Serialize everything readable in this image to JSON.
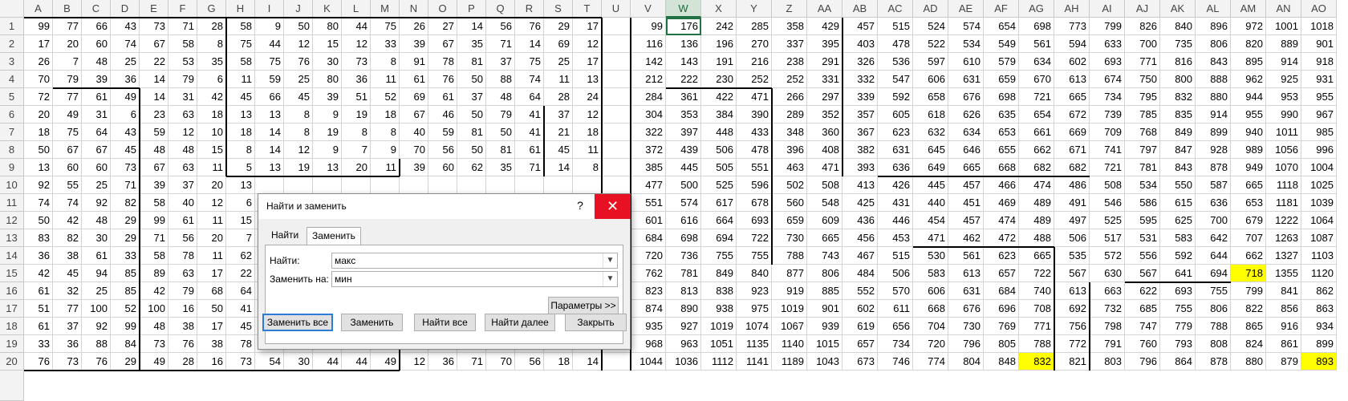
{
  "columns": [
    "A",
    "B",
    "C",
    "D",
    "E",
    "F",
    "G",
    "H",
    "I",
    "J",
    "K",
    "L",
    "M",
    "N",
    "O",
    "P",
    "Q",
    "R",
    "S",
    "T",
    "U",
    "V",
    "W",
    "X",
    "Y",
    "Z",
    "AA",
    "AB",
    "AC",
    "AD",
    "AE",
    "AF",
    "AG",
    "AH",
    "AI",
    "AJ",
    "AK",
    "AL",
    "AM",
    "AN",
    "AO"
  ],
  "rows": [
    "1",
    "2",
    "3",
    "4",
    "5",
    "6",
    "7",
    "8",
    "9",
    "10",
    "11",
    "12",
    "13",
    "14",
    "15",
    "16",
    "17",
    "18",
    "19",
    "20"
  ],
  "selected_column": "W",
  "active_cell": "W1",
  "highlighted_cells": [
    "AM15",
    "AG20",
    "AO20"
  ],
  "highlight_color": "#ffff00",
  "grid": [
    [
      "99",
      "77",
      "66",
      "43",
      "73",
      "71",
      "28",
      "58",
      "9",
      "50",
      "80",
      "44",
      "75",
      "26",
      "27",
      "14",
      "56",
      "76",
      "29",
      "17",
      "",
      "99",
      "176",
      "242",
      "285",
      "358",
      "429",
      "457",
      "515",
      "524",
      "574",
      "654",
      "698",
      "773",
      "799",
      "826",
      "840",
      "896",
      "972",
      "1001",
      "1018"
    ],
    [
      "17",
      "20",
      "60",
      "74",
      "67",
      "58",
      "8",
      "75",
      "44",
      "12",
      "15",
      "12",
      "33",
      "39",
      "67",
      "35",
      "71",
      "14",
      "69",
      "12",
      "",
      "116",
      "136",
      "196",
      "270",
      "337",
      "395",
      "403",
      "478",
      "522",
      "534",
      "549",
      "561",
      "594",
      "633",
      "700",
      "735",
      "806",
      "820",
      "889",
      "901"
    ],
    [
      "26",
      "7",
      "48",
      "25",
      "22",
      "53",
      "35",
      "58",
      "75",
      "76",
      "30",
      "73",
      "8",
      "91",
      "78",
      "81",
      "37",
      "75",
      "25",
      "17",
      "",
      "142",
      "143",
      "191",
      "216",
      "238",
      "291",
      "326",
      "536",
      "597",
      "610",
      "579",
      "634",
      "602",
      "693",
      "771",
      "816",
      "843",
      "895",
      "914",
      "918"
    ],
    [
      "70",
      "79",
      "39",
      "36",
      "14",
      "79",
      "6",
      "11",
      "59",
      "25",
      "80",
      "36",
      "11",
      "61",
      "76",
      "50",
      "88",
      "74",
      "11",
      "13",
      "",
      "212",
      "222",
      "230",
      "252",
      "252",
      "331",
      "332",
      "547",
      "606",
      "631",
      "659",
      "670",
      "613",
      "674",
      "750",
      "800",
      "888",
      "962",
      "925",
      "931"
    ],
    [
      "72",
      "77",
      "61",
      "49",
      "14",
      "31",
      "42",
      "45",
      "66",
      "45",
      "39",
      "51",
      "52",
      "69",
      "61",
      "37",
      "48",
      "64",
      "28",
      "24",
      "",
      "284",
      "361",
      "422",
      "471",
      "266",
      "297",
      "339",
      "592",
      "658",
      "676",
      "698",
      "721",
      "665",
      "734",
      "795",
      "832",
      "880",
      "944",
      "953",
      "955"
    ],
    [
      "20",
      "49",
      "31",
      "6",
      "23",
      "63",
      "18",
      "13",
      "13",
      "8",
      "9",
      "19",
      "18",
      "67",
      "46",
      "50",
      "79",
      "41",
      "37",
      "12",
      "",
      "304",
      "353",
      "384",
      "390",
      "289",
      "352",
      "357",
      "605",
      "618",
      "626",
      "635",
      "654",
      "672",
      "739",
      "785",
      "835",
      "914",
      "955",
      "990",
      "967"
    ],
    [
      "18",
      "75",
      "64",
      "43",
      "59",
      "12",
      "10",
      "18",
      "14",
      "8",
      "19",
      "8",
      "8",
      "40",
      "59",
      "81",
      "50",
      "41",
      "21",
      "18",
      "",
      "322",
      "397",
      "448",
      "433",
      "348",
      "360",
      "367",
      "623",
      "632",
      "634",
      "653",
      "661",
      "669",
      "709",
      "768",
      "849",
      "899",
      "940",
      "1011",
      "985"
    ],
    [
      "50",
      "67",
      "67",
      "45",
      "48",
      "48",
      "15",
      "8",
      "14",
      "12",
      "9",
      "7",
      "9",
      "70",
      "56",
      "50",
      "81",
      "61",
      "45",
      "11",
      "",
      "372",
      "439",
      "506",
      "478",
      "396",
      "408",
      "382",
      "631",
      "645",
      "646",
      "655",
      "662",
      "671",
      "741",
      "797",
      "847",
      "928",
      "989",
      "1056",
      "996"
    ],
    [
      "13",
      "60",
      "60",
      "73",
      "67",
      "63",
      "11",
      "5",
      "13",
      "19",
      "13",
      "20",
      "11",
      "39",
      "60",
      "62",
      "35",
      "71",
      "14",
      "8",
      "",
      "385",
      "445",
      "505",
      "551",
      "463",
      "471",
      "393",
      "636",
      "649",
      "665",
      "668",
      "682",
      "682",
      "721",
      "781",
      "843",
      "878",
      "949",
      "1070",
      "1004"
    ],
    [
      "92",
      "55",
      "25",
      "71",
      "39",
      "37",
      "20",
      "13",
      "",
      "",
      "",
      "",
      "",
      "",
      "",
      "",
      "",
      "",
      "",
      "",
      "",
      "477",
      "500",
      "525",
      "596",
      "502",
      "508",
      "413",
      "426",
      "445",
      "457",
      "466",
      "474",
      "486",
      "508",
      "534",
      "550",
      "587",
      "665",
      "1118",
      "1025"
    ],
    [
      "74",
      "74",
      "92",
      "82",
      "58",
      "40",
      "12",
      "6",
      "",
      "",
      "",
      "",
      "",
      "",
      "",
      "",
      "",
      "",
      "",
      "",
      "",
      "551",
      "574",
      "617",
      "678",
      "560",
      "548",
      "425",
      "431",
      "440",
      "451",
      "469",
      "489",
      "491",
      "546",
      "586",
      "615",
      "636",
      "653",
      "1181",
      "1039"
    ],
    [
      "50",
      "42",
      "48",
      "29",
      "99",
      "61",
      "11",
      "15",
      "",
      "",
      "",
      "",
      "",
      "",
      "",
      "",
      "",
      "",
      "",
      "",
      "",
      "601",
      "616",
      "664",
      "693",
      "659",
      "609",
      "436",
      "446",
      "454",
      "457",
      "474",
      "489",
      "497",
      "525",
      "595",
      "625",
      "700",
      "679",
      "1222",
      "1064"
    ],
    [
      "83",
      "82",
      "30",
      "29",
      "71",
      "56",
      "20",
      "7",
      "",
      "",
      "",
      "",
      "",
      "",
      "",
      "",
      "",
      "",
      "",
      "",
      "",
      "684",
      "698",
      "694",
      "722",
      "730",
      "665",
      "456",
      "453",
      "471",
      "462",
      "472",
      "488",
      "506",
      "517",
      "531",
      "583",
      "642",
      "707",
      "1263",
      "1087"
    ],
    [
      "36",
      "38",
      "61",
      "33",
      "58",
      "78",
      "11",
      "62",
      "",
      "",
      "",
      "",
      "",
      "",
      "",
      "",
      "",
      "",
      "",
      "",
      "",
      "720",
      "736",
      "755",
      "755",
      "788",
      "743",
      "467",
      "515",
      "530",
      "561",
      "623",
      "665",
      "535",
      "572",
      "556",
      "592",
      "644",
      "662",
      "1327",
      "1103"
    ],
    [
      "42",
      "45",
      "94",
      "85",
      "89",
      "63",
      "17",
      "22",
      "",
      "",
      "",
      "",
      "",
      "",
      "",
      "",
      "",
      "",
      "",
      "",
      "",
      "762",
      "781",
      "849",
      "840",
      "877",
      "806",
      "484",
      "506",
      "583",
      "613",
      "657",
      "722",
      "567",
      "630",
      "567",
      "641",
      "694",
      "718",
      "1355",
      "1120"
    ],
    [
      "61",
      "32",
      "25",
      "85",
      "42",
      "79",
      "68",
      "64",
      "",
      "",
      "",
      "",
      "",
      "",
      "",
      "",
      "",
      "",
      "",
      "",
      "",
      "823",
      "813",
      "838",
      "923",
      "919",
      "885",
      "552",
      "570",
      "606",
      "631",
      "684",
      "740",
      "613",
      "663",
      "622",
      "693",
      "755",
      "799",
      "841",
      "862"
    ],
    [
      "51",
      "77",
      "100",
      "52",
      "100",
      "16",
      "50",
      "41",
      "",
      "",
      "",
      "",
      "",
      "",
      "",
      "",
      "",
      "",
      "",
      "",
      "",
      "874",
      "890",
      "938",
      "975",
      "1019",
      "901",
      "602",
      "611",
      "668",
      "676",
      "696",
      "708",
      "692",
      "732",
      "685",
      "755",
      "806",
      "822",
      "856",
      "863"
    ],
    [
      "61",
      "37",
      "92",
      "99",
      "48",
      "38",
      "17",
      "45",
      "",
      "",
      "",
      "",
      "",
      "",
      "",
      "",
      "",
      "",
      "",
      "",
      "",
      "935",
      "927",
      "1019",
      "1074",
      "1067",
      "939",
      "619",
      "656",
      "704",
      "730",
      "769",
      "771",
      "756",
      "798",
      "747",
      "779",
      "788",
      "865",
      "916",
      "934"
    ],
    [
      "33",
      "36",
      "88",
      "84",
      "73",
      "76",
      "38",
      "78",
      "16",
      "76",
      "36",
      "17",
      "16",
      "19",
      "13",
      "33",
      "20",
      "16",
      "37",
      "38",
      "",
      "968",
      "963",
      "1051",
      "1135",
      "1140",
      "1015",
      "657",
      "734",
      "720",
      "796",
      "805",
      "788",
      "772",
      "791",
      "760",
      "793",
      "808",
      "824",
      "861",
      "899"
    ],
    [
      "76",
      "73",
      "76",
      "29",
      "49",
      "28",
      "16",
      "73",
      "54",
      "30",
      "44",
      "44",
      "49",
      "12",
      "36",
      "71",
      "70",
      "56",
      "18",
      "14",
      "",
      "1044",
      "1036",
      "1112",
      "1141",
      "1189",
      "1043",
      "673",
      "746",
      "774",
      "804",
      "848",
      "832",
      "821",
      "803",
      "796",
      "864",
      "878",
      "880",
      "879",
      "893"
    ]
  ],
  "dialog": {
    "title": "Найти и заменить",
    "help": "?",
    "close": "✕",
    "tabs": [
      "Найти",
      "Заменить"
    ],
    "active_tab": "Заменить",
    "find_label": "Найти:",
    "find_value": "макс",
    "replace_label": "Заменить на:",
    "replace_value": "мин",
    "dropdown_icon": "chevron-down-icon",
    "options_button": "Параметры >>",
    "buttons": {
      "replace_all": "Заменить все",
      "replace": "Заменить",
      "find_all": "Найти все",
      "find_next": "Найти далее",
      "close": "Закрыть"
    }
  }
}
